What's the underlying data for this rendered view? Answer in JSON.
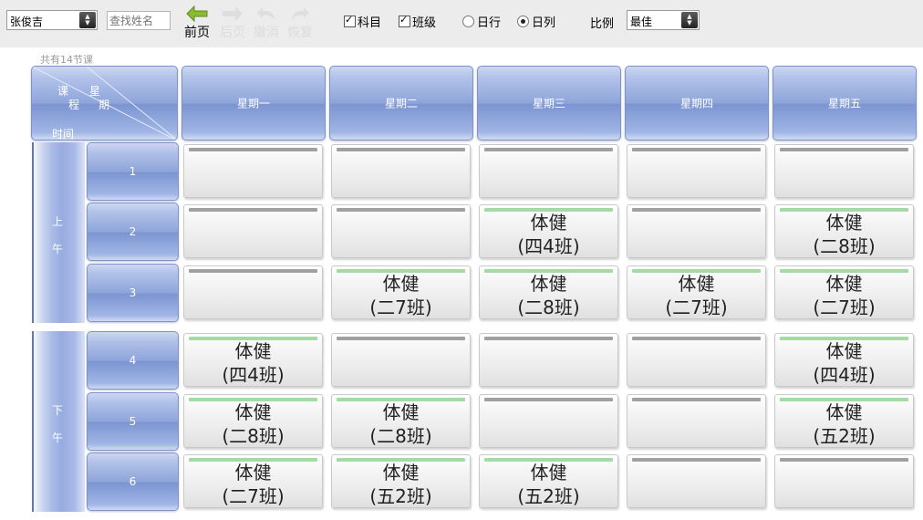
{
  "toolbar": {
    "teacher_select": "张俊吉",
    "search_placeholder": "查找姓名",
    "prev_label": "前页",
    "next_label": "后页",
    "undo_label": "撤消",
    "redo_label": "恢复",
    "subject_label": "科目",
    "subject_checked": true,
    "class_label": "班级",
    "class_checked": true,
    "row_label": "日行",
    "col_label": "日列",
    "selected_layout": "日列",
    "scale_label": "比例",
    "scale_value": "最佳",
    "colors": {
      "prev_arrow": "#7fae2c",
      "disabled": "#dcdcdc"
    },
    "icons": [
      "arrow-left-icon",
      "arrow-right-icon",
      "undo-icon",
      "redo-icon"
    ]
  },
  "schedule": {
    "lesson_count": "共有14节课",
    "corner": {
      "lesson": "课",
      "period": "程",
      "week1": "星",
      "week2": "期",
      "time": "时间"
    },
    "days": [
      "星期一",
      "星期二",
      "星期三",
      "星期四",
      "星期五"
    ],
    "morning": [
      "上",
      "午"
    ],
    "afternoon": [
      "下",
      "午"
    ],
    "periods": [
      {
        "label": "1",
        "slots": [
          null,
          null,
          null,
          null,
          null
        ]
      },
      {
        "label": "2",
        "slots": [
          null,
          null,
          {
            "subject": "体健",
            "class": "(四4班)"
          },
          null,
          {
            "subject": "体健",
            "class": "(二8班)"
          }
        ]
      },
      {
        "label": "3",
        "slots": [
          null,
          {
            "subject": "体健",
            "class": "(二7班)"
          },
          {
            "subject": "体健",
            "class": "(二8班)"
          },
          {
            "subject": "体健",
            "class": "(二7班)"
          },
          {
            "subject": "体健",
            "class": "(二7班)"
          }
        ]
      },
      {
        "label": "4",
        "slots": [
          {
            "subject": "体健",
            "class": "(四4班)"
          },
          null,
          null,
          null,
          {
            "subject": "体健",
            "class": "(四4班)"
          }
        ]
      },
      {
        "label": "5",
        "slots": [
          {
            "subject": "体健",
            "class": "(二8班)"
          },
          {
            "subject": "体健",
            "class": "(二8班)"
          },
          null,
          null,
          {
            "subject": "体健",
            "class": "(五2班)"
          }
        ]
      },
      {
        "label": "6",
        "slots": [
          {
            "subject": "体健",
            "class": "(二7班)"
          },
          {
            "subject": "体健",
            "class": "(五2班)"
          },
          {
            "subject": "体健",
            "class": "(五2班)"
          },
          null,
          null
        ]
      }
    ],
    "colors": {
      "header_blue": "#8ea5da",
      "filled_bar": "#a2dba4",
      "empty_bar": "#a0a0a0"
    }
  }
}
